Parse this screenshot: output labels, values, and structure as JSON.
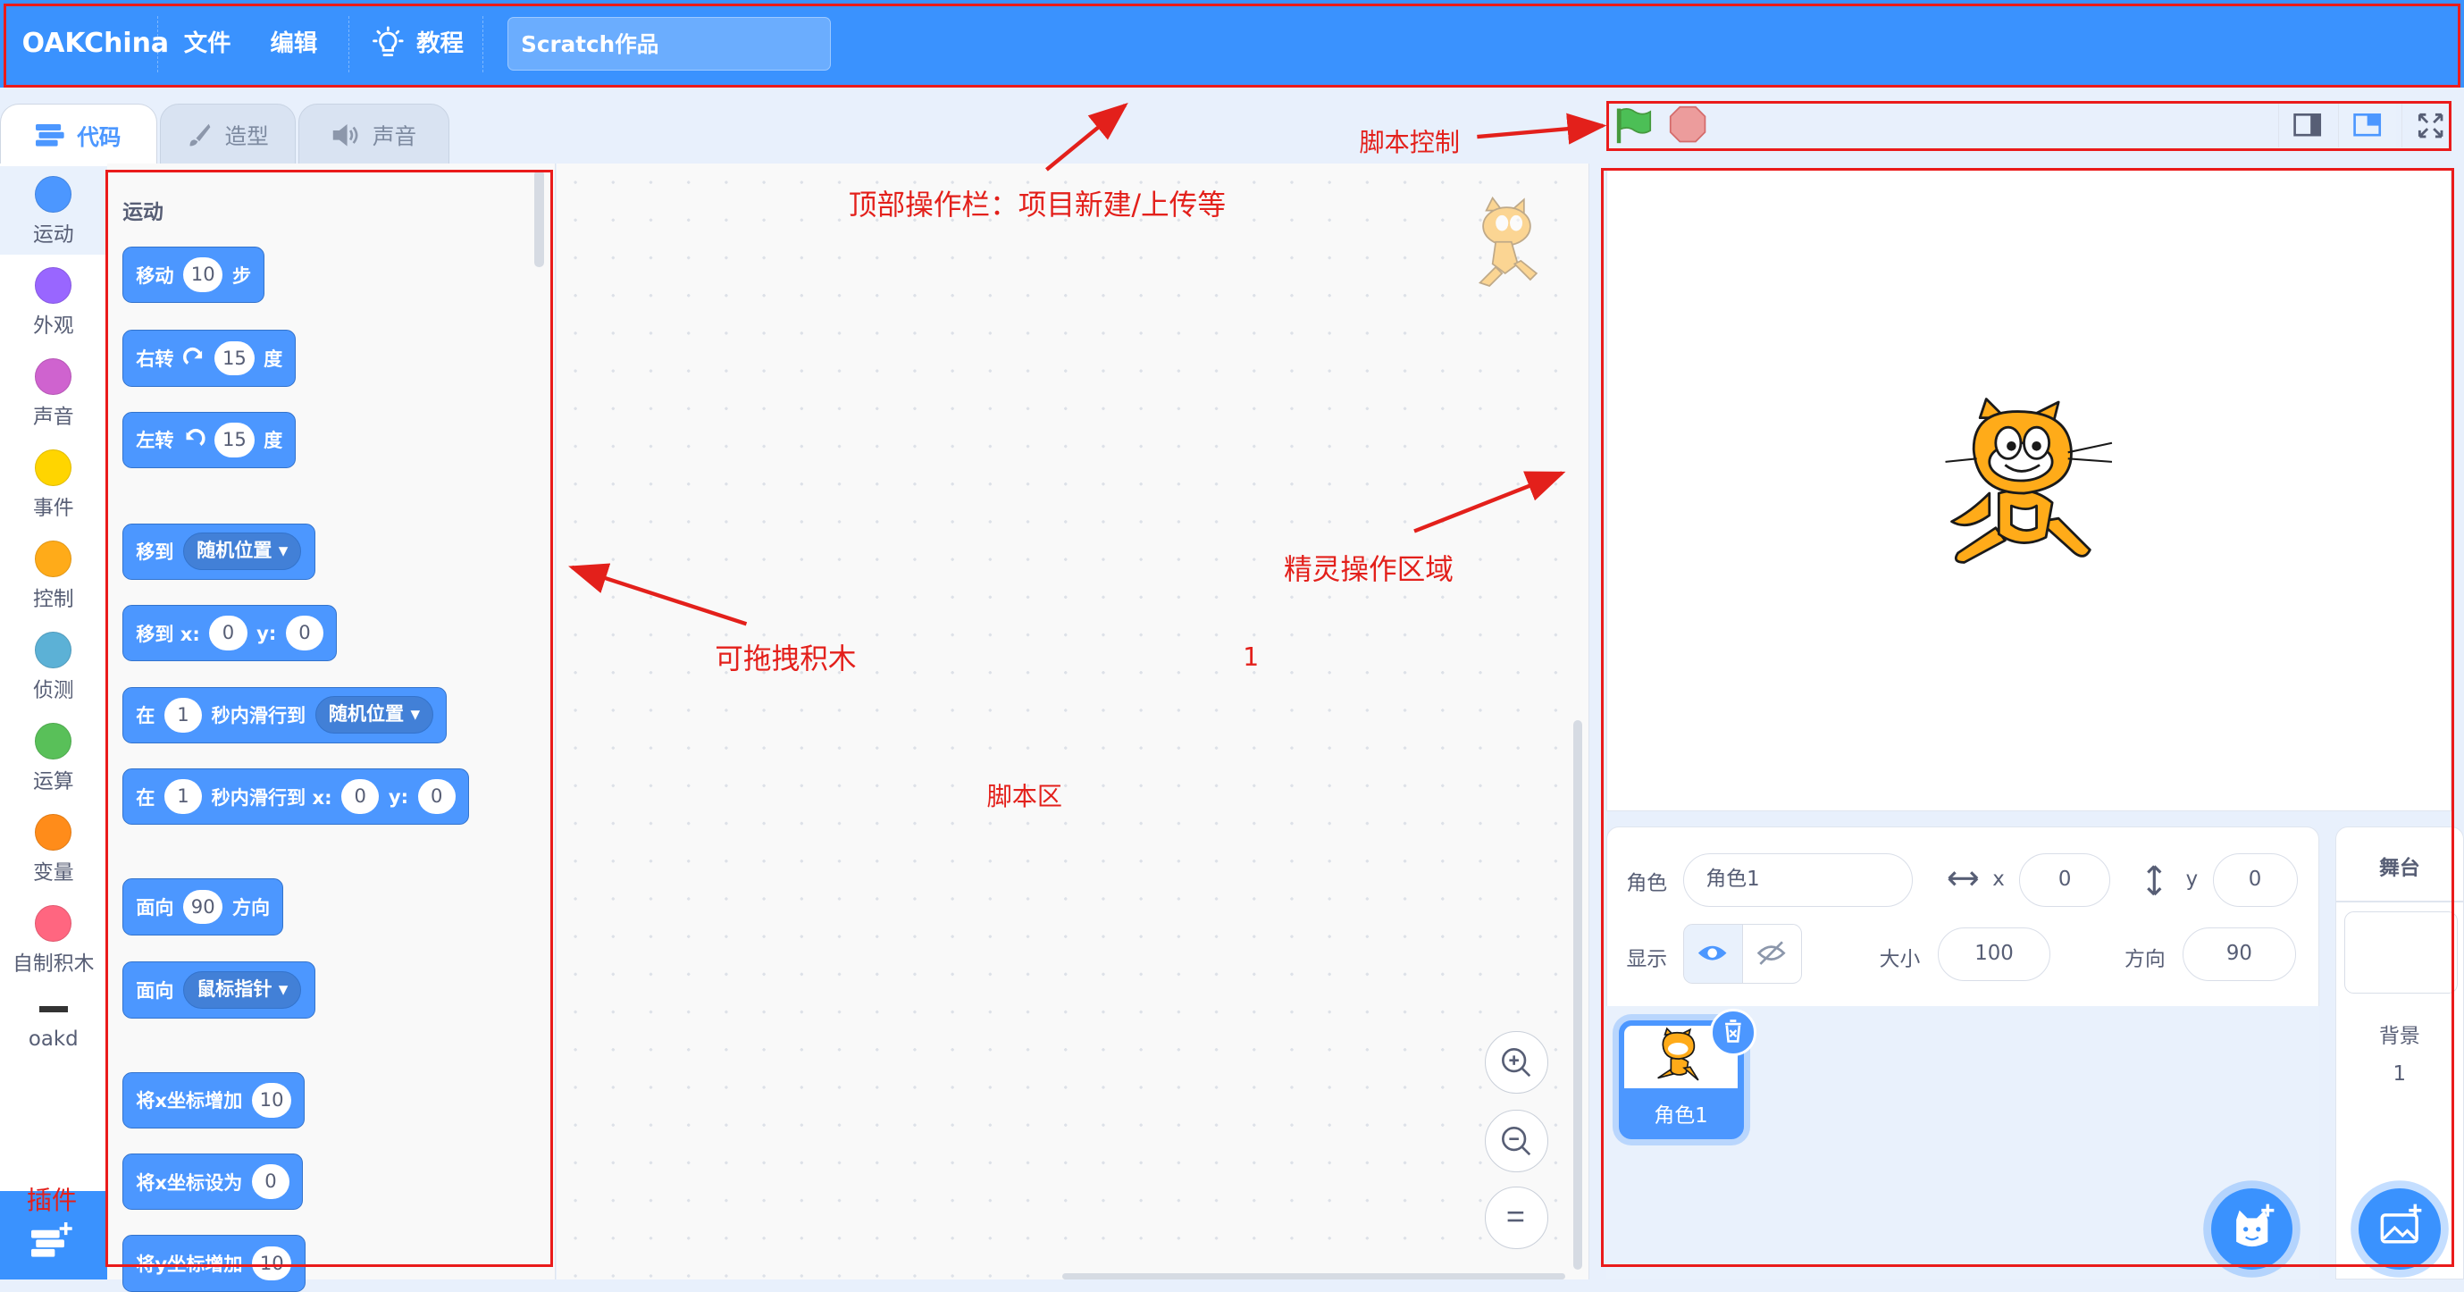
{
  "menubar": {
    "logo": "OAKChina",
    "file": "文件",
    "edit": "编辑",
    "tutorials": "教程",
    "project_title": "Scratch作品"
  },
  "tabs": [
    {
      "label": "代码",
      "icon": "code-icon",
      "active": true
    },
    {
      "label": "造型",
      "icon": "brush-icon",
      "active": false
    },
    {
      "label": "声音",
      "icon": "speaker-icon",
      "active": false
    }
  ],
  "categories": [
    {
      "label": "运动",
      "color": "#4c97ff"
    },
    {
      "label": "外观",
      "color": "#9966ff"
    },
    {
      "label": "声音",
      "color": "#cf63cf"
    },
    {
      "label": "事件",
      "color": "#ffd500"
    },
    {
      "label": "控制",
      "color": "#ffab19"
    },
    {
      "label": "侦测",
      "color": "#5cb1d6"
    },
    {
      "label": "运算",
      "color": "#59c059"
    },
    {
      "label": "变量",
      "color": "#ff8c1a"
    },
    {
      "label": "自制积木",
      "color": "#ff6680"
    },
    {
      "label": "oakd",
      "color": "#333333"
    }
  ],
  "palette": {
    "section_title": "运动",
    "blocks": {
      "move": {
        "label": "移动",
        "value": "10",
        "unit": "步"
      },
      "turn_right": {
        "label": "右转",
        "value": "15",
        "unit": "度"
      },
      "turn_left": {
        "label": "左转",
        "value": "15",
        "unit": "度"
      },
      "goto": {
        "label": "移到",
        "option": "随机位置"
      },
      "goto_xy": {
        "label": "移到 x:",
        "x": "0",
        "y_label": "y:",
        "y": "0"
      },
      "glide": {
        "label": "在",
        "secs": "1",
        "mid": "秒内滑行到",
        "option": "随机位置"
      },
      "glide_xy": {
        "label": "在",
        "secs": "1",
        "mid": "秒内滑行到 x:",
        "x": "0",
        "y_label": "y:",
        "y": "0"
      },
      "point_dir": {
        "label": "面向",
        "value": "90",
        "unit": "方向"
      },
      "point_towards": {
        "label": "面向",
        "option": "鼠标指针"
      },
      "change_x": {
        "label": "将x坐标增加",
        "value": "10"
      },
      "set_x": {
        "label": "将x坐标设为",
        "value": "0"
      },
      "change_y": {
        "label": "将y坐标增加",
        "value": "10"
      }
    }
  },
  "sprite_info": {
    "sprite_label": "角色",
    "sprite_name": "角色1",
    "x_label": "x",
    "x": "0",
    "y_label": "y",
    "y": "0",
    "show_label": "显示",
    "size_label": "大小",
    "size": "100",
    "direction_label": "方向",
    "direction": "90"
  },
  "sprite_list": [
    {
      "name": "角色1"
    }
  ],
  "stage_pane": {
    "title": "舞台",
    "backdrop_label": "背景",
    "backdrop_count": "1"
  },
  "annotations": {
    "top_bar": "顶部操作栏：项目新建/上传等",
    "script_control": "脚本控制",
    "sprite_area": "精灵操作区域",
    "blocks": "可拖拽积木",
    "script_area": "脚本区",
    "marker": "1",
    "plugin": "插件"
  },
  "colors": {
    "menubar": "#3a92fe",
    "motion": "#4c97ff",
    "annotation_red": "#e3201b"
  }
}
